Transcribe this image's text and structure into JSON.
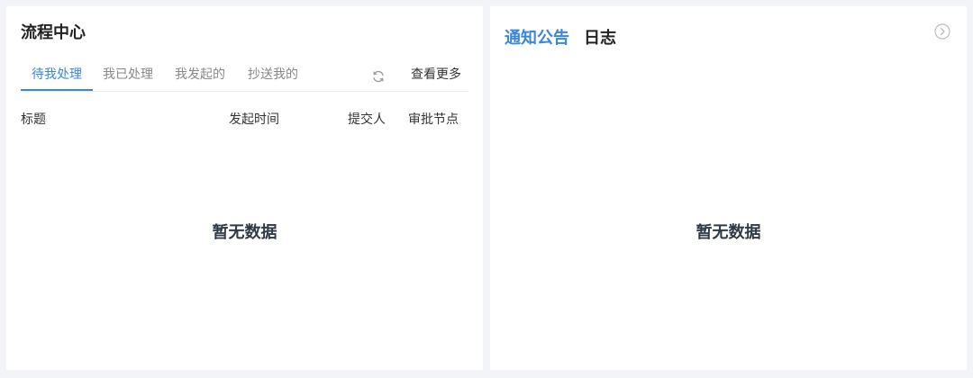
{
  "process_center": {
    "title": "流程中心",
    "tabs": [
      {
        "label": "待我处理",
        "active": true
      },
      {
        "label": "我已处理",
        "active": false
      },
      {
        "label": "我发起的",
        "active": false
      },
      {
        "label": "抄送我的",
        "active": false
      }
    ],
    "refresh_icon": "refresh-icon",
    "view_more_label": "查看更多",
    "columns": [
      "标题",
      "发起时间",
      "提交人",
      "审批节点"
    ],
    "empty_text": "暂无数据"
  },
  "notice": {
    "tabs": [
      {
        "label": "通知公告",
        "active": true
      },
      {
        "label": "日志",
        "active": false
      }
    ],
    "more_icon": "chevron-right-circle-icon",
    "empty_text": "暂无数据"
  },
  "colors": {
    "accent": "#3a86d8",
    "background": "#f3f4f8",
    "panel": "#ffffff"
  }
}
